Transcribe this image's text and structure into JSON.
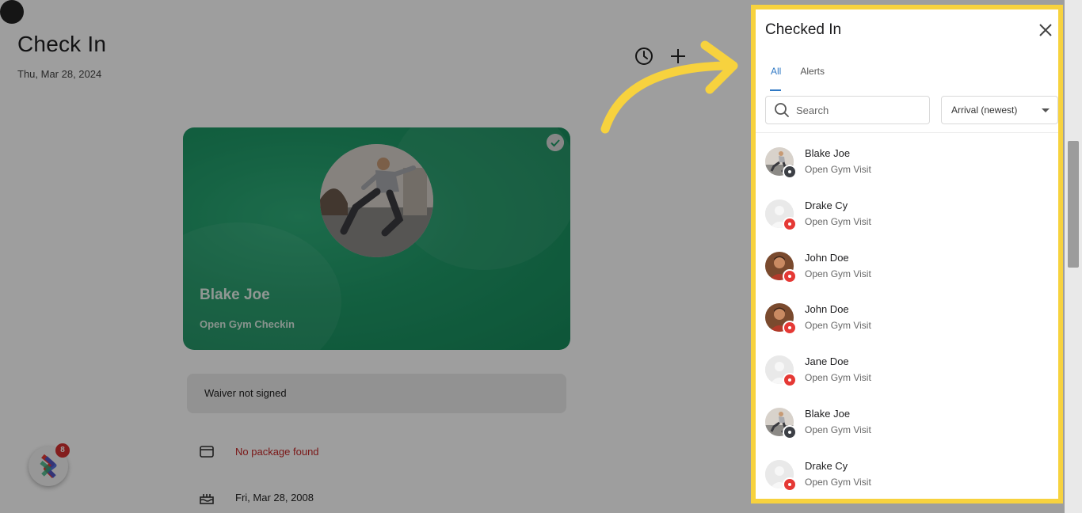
{
  "page": {
    "title": "Check In",
    "date": "Thu, Mar 28, 2024"
  },
  "header": {
    "icons": [
      "clock-icon",
      "plus-icon",
      "avatar"
    ]
  },
  "card": {
    "name": "Blake Joe",
    "subtitle": "Open Gym Checkin"
  },
  "waiver": {
    "text": "Waiver not signed"
  },
  "details": {
    "package": "No package found",
    "birthday": "Fri, Mar 28, 2008"
  },
  "chat_bubble": {
    "badge": "8"
  },
  "drawer": {
    "title": "Checked In",
    "tabs": [
      {
        "label": "All",
        "active": true
      },
      {
        "label": "Alerts",
        "active": false
      }
    ],
    "search_placeholder": "Search",
    "sort_value": "Arrival (newest)",
    "items": [
      {
        "name": "Blake Joe",
        "visit": "Open Gym Visit",
        "avatar": "photo-athlete",
        "status": "dark"
      },
      {
        "name": "Drake Cy",
        "visit": "Open Gym Visit",
        "avatar": "placeholder",
        "status": "red"
      },
      {
        "name": "John Doe",
        "visit": "Open Gym Visit",
        "avatar": "photo-man",
        "status": "red"
      },
      {
        "name": "John Doe",
        "visit": "Open Gym Visit",
        "avatar": "photo-man",
        "status": "red"
      },
      {
        "name": "Jane Doe",
        "visit": "Open Gym Visit",
        "avatar": "placeholder",
        "status": "red"
      },
      {
        "name": "Blake Joe",
        "visit": "Open Gym Visit",
        "avatar": "photo-athlete",
        "status": "dark"
      },
      {
        "name": "Drake Cy",
        "visit": "Open Gym Visit",
        "avatar": "placeholder",
        "status": "red"
      }
    ]
  },
  "colors": {
    "highlight": "#f7d23e",
    "accent": "#2f78c4",
    "card_green": "#1f9a68",
    "alert_red": "#e53935",
    "status_dark": "#3c3f45"
  }
}
